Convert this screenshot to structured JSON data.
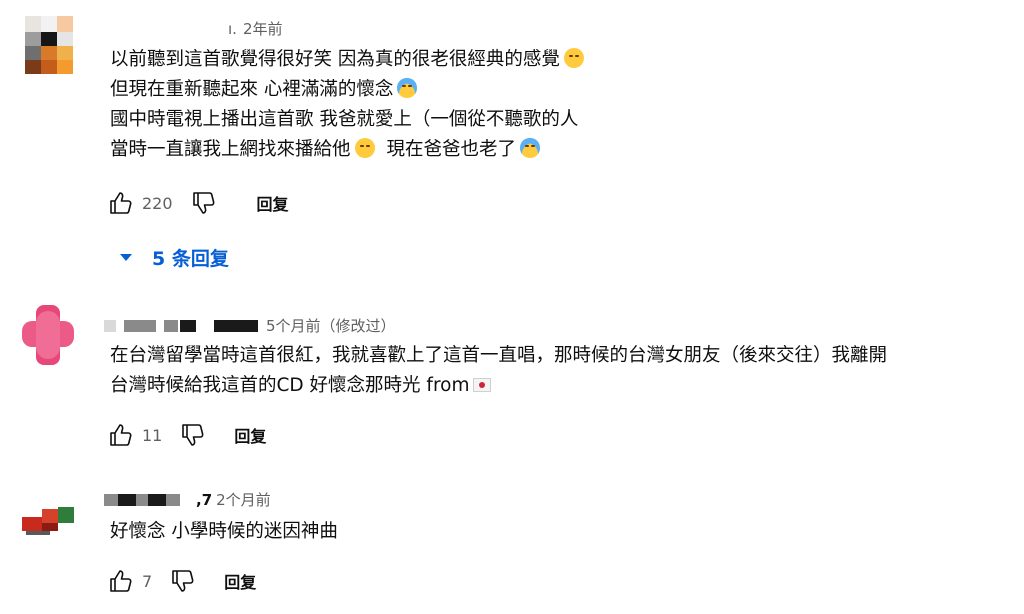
{
  "comments": [
    {
      "author_suffix": "ı.",
      "time": "2年前",
      "lines": [
        "以前聽到這首歌覺得很好笑  因為真的很老很經典的感覺",
        "但現在重新聽起來  心裡滿滿的懷念",
        "國中時電視上播出這首歌  我爸就愛上（一個從不聽歌的人",
        "當時一直讓我上網找來播給他",
        "現在爸爸也老了"
      ],
      "likes": "220",
      "reply_label": "回复",
      "replies_toggle": "5 条回复"
    },
    {
      "author_suffix": "",
      "time": "5个月前（修改过）",
      "lines": [
        "在台灣留學當時這首很紅，我就喜歡上了這首一直唱，那時候的台灣女朋友（後來交往）我離開",
        "台灣時候給我這首的CD 好懷念那時光 from"
      ],
      "likes": "11",
      "reply_label": "回复"
    },
    {
      "author_suffix": ",7",
      "time": "2个月前",
      "lines": [
        "好懷念 小學時候的迷因神曲"
      ],
      "likes": "7",
      "reply_label": "回复"
    }
  ],
  "icons": {
    "like": "thumbs-up-icon",
    "dislike": "thumbs-down-icon",
    "emoji_laugh": "laughing-tears-emoji",
    "emoji_cry": "crying-emoji",
    "flag": "japan-flag-emoji"
  },
  "colors": {
    "link_blue": "#065fd4",
    "meta_gray": "#606060",
    "text": "#0f0f0f"
  }
}
